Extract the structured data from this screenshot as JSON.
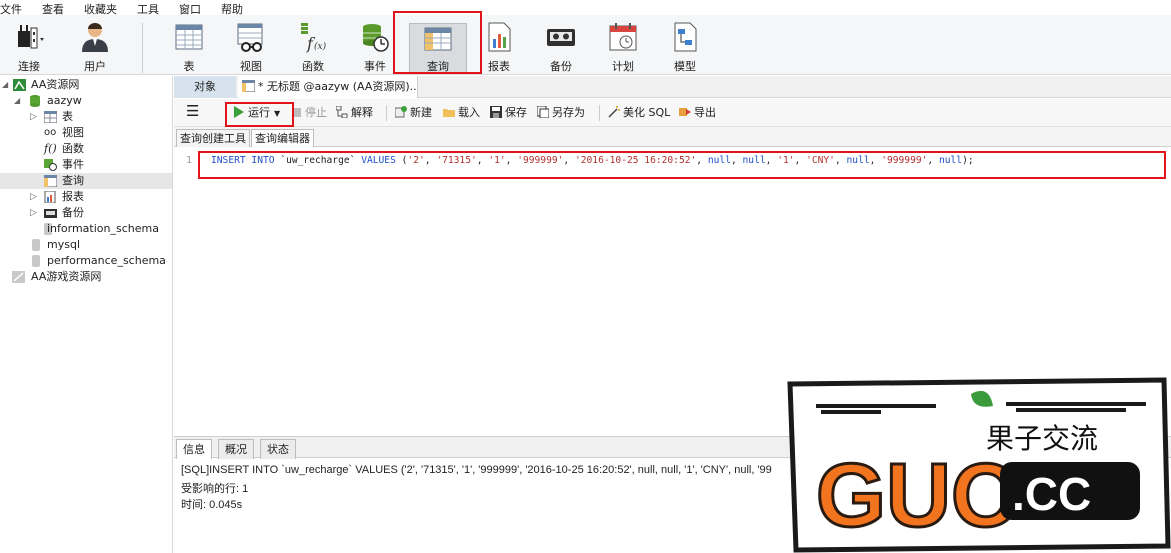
{
  "menu": [
    "文件",
    "查看",
    "收藏夹",
    "工具",
    "窗口",
    "帮助"
  ],
  "main_toolbar": {
    "connect": "连接",
    "user": "用户",
    "table": "表",
    "view": "视图",
    "function": "函数",
    "event": "事件",
    "query": "查询",
    "report": "报表",
    "backup": "备份",
    "schedule": "计划",
    "model": "模型"
  },
  "tree": {
    "root": "AA资源网",
    "db": "aazyw",
    "items": [
      "表",
      "视图",
      "函数",
      "事件",
      "查询",
      "报表",
      "备份"
    ],
    "other_dbs": [
      "information_schema",
      "mysql",
      "performance_schema"
    ],
    "root2": "AA游戏资源网"
  },
  "tabs": {
    "objects": "对象",
    "document": "* 无标题 @aazyw (AA资源网)..."
  },
  "query_toolbar": {
    "run": "运行",
    "stop": "停止",
    "explain": "解释",
    "new": "新建",
    "load": "载入",
    "save": "保存",
    "save_as": "另存为",
    "beautify": "美化 SQL",
    "export": "导出"
  },
  "subtabs": [
    "查询创建工具",
    "查询编辑器"
  ],
  "editor": {
    "line_number": "1",
    "sql": {
      "insert": "INSERT INTO",
      "table": "`uw_recharge`",
      "values": "VALUES",
      "v1": "'2'",
      "v2": "'71315'",
      "v3": "'1'",
      "v4": "'999999'",
      "v5": "'2016-10-25 16:20:52'",
      "null": "null",
      "v8": "'1'",
      "v9": "'CNY'",
      "v11": "'999999'"
    }
  },
  "bottom_tabs": [
    "信息",
    "概况",
    "状态"
  ],
  "messages": {
    "sql": "[SQL]INSERT INTO `uw_recharge` VALUES ('2', '71315', '1', '999999', '2016-10-25 16:20:52', null, null, '1', 'CNY', null, '99",
    "affected": "受影响的行: 1",
    "time": "时间: 0.045s"
  },
  "watermark": {
    "brand": "GUO",
    "domain": ".CC",
    "slogan": "果子交流"
  },
  "colors": {
    "highlight_red": "#e0151b",
    "keyword_blue": "#1f4fc8",
    "string_red": "#b0312f",
    "watermark_orange": "#f2741f"
  }
}
